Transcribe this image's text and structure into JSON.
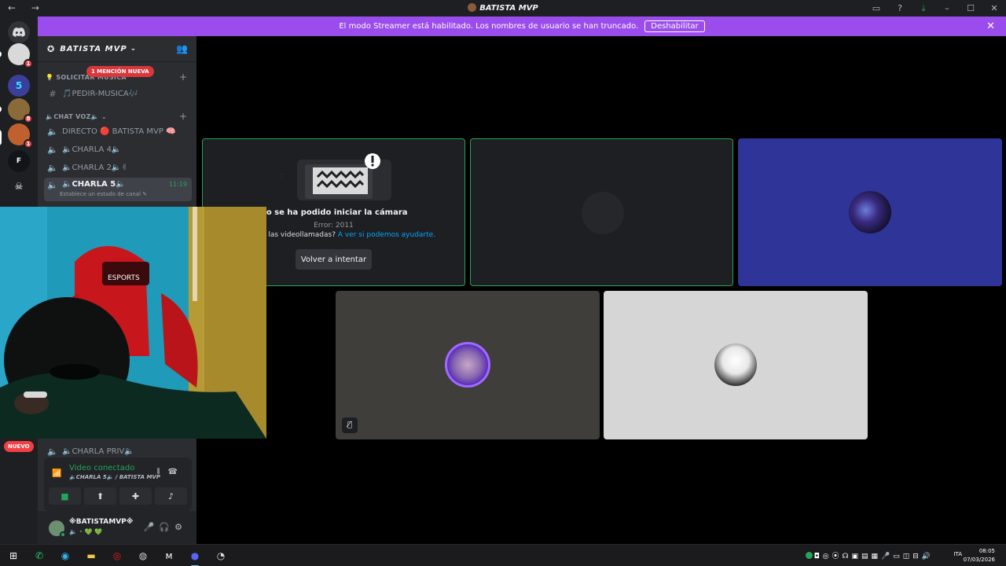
{
  "window": {
    "nav": "← →",
    "title": "BATISTA MVP",
    "controls": [
      "▭",
      "?",
      "⤓",
      "–",
      "☐",
      "✕"
    ]
  },
  "banner": {
    "text": "El modo Streamer está habilitado. Los nombres de usuario se han truncado.",
    "button": "Deshabilitar",
    "close": "✕"
  },
  "rail": {
    "home_icon": "discord-icon",
    "servers": [
      {
        "name": "server-avatar-manga",
        "badge": "1",
        "color": "#d9d9d9"
      },
      {
        "name": "server-5",
        "glyph": "5",
        "color": "#3b3f9b"
      },
      {
        "name": "server-pets",
        "badge": "8",
        "color": "#8b6a3a"
      },
      {
        "name": "server-batista",
        "badge": "1",
        "color": "#c0602e"
      },
      {
        "name": "server-logo",
        "glyph": "F",
        "color": "#11151a"
      },
      {
        "name": "server-skull",
        "glyph": "☠",
        "color": "#1e1f22"
      }
    ]
  },
  "sidebar": {
    "guild_name": "BATISTA MVP",
    "mention_badge": "1 MENCIÓN NUEVA",
    "category_request": "SOLICITAR MÚSICA",
    "channel_request": "🎵PEDIR-MUSICA🎶",
    "category_voice": "🔈CHAT VOZ🔈",
    "channels": [
      {
        "label": "DIRECTO 🔴 BATISTA MVP 🧠"
      },
      {
        "label": "🔈CHARLA 4🔈"
      },
      {
        "label": "🔈CHARLA 2🔈✌"
      },
      {
        "label": "🔈CHARLA 5🔈",
        "time": "11:19",
        "sub": "Establece un estado de canal ✎"
      },
      {
        "label": "🔈CHARLA PRIV🔈"
      }
    ],
    "new_badge": "NUEVO"
  },
  "voice_panel": {
    "status": "Video conectado",
    "channel": "🔈CHARLA 5🔈 / BATISTA MVP"
  },
  "user": {
    "name": "※BATISTAMVP※",
    "status": "🔈 • 💚 💚"
  },
  "tiles": {
    "error_title": "No se ha podido iniciar la cámara",
    "error_code": "Error: 2011",
    "help_text": "emas con las videollamadas?",
    "help_link": "A ver si podemos ayudarte.",
    "retry": "Volver a intentar"
  },
  "taskbar": {
    "language": "ITA",
    "time": "08:05",
    "date": "07/03/2026"
  }
}
